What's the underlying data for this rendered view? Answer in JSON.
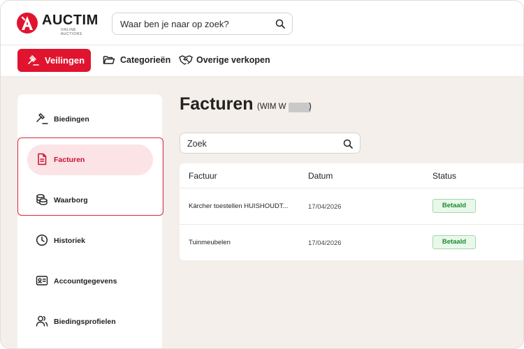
{
  "brand": {
    "name": "AUCTIM",
    "tagline": "ONLINE AUCTIONS",
    "accent": "#e0142e"
  },
  "header": {
    "search_placeholder": "Waar ben je naar op zoek?",
    "search_icon": "search-icon"
  },
  "nav": {
    "primary_label": "Veilingen",
    "items": [
      {
        "label": "Categorieën",
        "icon": "folder-icon"
      },
      {
        "label": "Overige verkopen",
        "icon": "handshake-icon"
      }
    ]
  },
  "sidebar": {
    "items": [
      {
        "label": "Biedingen",
        "icon": "gavel-icon"
      },
      {
        "label": "Facturen",
        "icon": "invoice-icon",
        "active": true
      },
      {
        "label": "Waarborg",
        "icon": "coins-icon"
      },
      {
        "label": "Historiek",
        "icon": "clock-icon"
      },
      {
        "label": "Accountgegevens",
        "icon": "id-card-icon"
      },
      {
        "label": "Biedingsprofielen",
        "icon": "users-icon"
      }
    ]
  },
  "main": {
    "title": "Facturen",
    "subtitle": "(WIM W",
    "subtitle_close": ")",
    "search_placeholder": "Zoek",
    "columns": [
      "Factuur",
      "Datum",
      "Status"
    ],
    "rows": [
      {
        "factuur": "Kärcher toestellen HUISHOUDT...",
        "datum": "17/04/2026",
        "status": "Betaald"
      },
      {
        "factuur": "Tuinmeubelen",
        "datum": "17/04/2026",
        "status": "Betaald"
      }
    ],
    "status_color": "#1d8a2d"
  }
}
